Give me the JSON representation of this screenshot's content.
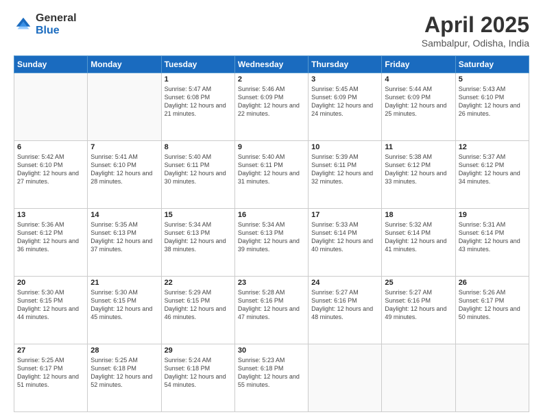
{
  "logo": {
    "general": "General",
    "blue": "Blue"
  },
  "title": {
    "month": "April 2025",
    "location": "Sambalpur, Odisha, India"
  },
  "weekdays": [
    "Sunday",
    "Monday",
    "Tuesday",
    "Wednesday",
    "Thursday",
    "Friday",
    "Saturday"
  ],
  "weeks": [
    [
      {
        "day": "",
        "sunrise": "",
        "sunset": "",
        "daylight": ""
      },
      {
        "day": "",
        "sunrise": "",
        "sunset": "",
        "daylight": ""
      },
      {
        "day": "1",
        "sunrise": "Sunrise: 5:47 AM",
        "sunset": "Sunset: 6:08 PM",
        "daylight": "Daylight: 12 hours and 21 minutes."
      },
      {
        "day": "2",
        "sunrise": "Sunrise: 5:46 AM",
        "sunset": "Sunset: 6:09 PM",
        "daylight": "Daylight: 12 hours and 22 minutes."
      },
      {
        "day": "3",
        "sunrise": "Sunrise: 5:45 AM",
        "sunset": "Sunset: 6:09 PM",
        "daylight": "Daylight: 12 hours and 24 minutes."
      },
      {
        "day": "4",
        "sunrise": "Sunrise: 5:44 AM",
        "sunset": "Sunset: 6:09 PM",
        "daylight": "Daylight: 12 hours and 25 minutes."
      },
      {
        "day": "5",
        "sunrise": "Sunrise: 5:43 AM",
        "sunset": "Sunset: 6:10 PM",
        "daylight": "Daylight: 12 hours and 26 minutes."
      }
    ],
    [
      {
        "day": "6",
        "sunrise": "Sunrise: 5:42 AM",
        "sunset": "Sunset: 6:10 PM",
        "daylight": "Daylight: 12 hours and 27 minutes."
      },
      {
        "day": "7",
        "sunrise": "Sunrise: 5:41 AM",
        "sunset": "Sunset: 6:10 PM",
        "daylight": "Daylight: 12 hours and 28 minutes."
      },
      {
        "day": "8",
        "sunrise": "Sunrise: 5:40 AM",
        "sunset": "Sunset: 6:11 PM",
        "daylight": "Daylight: 12 hours and 30 minutes."
      },
      {
        "day": "9",
        "sunrise": "Sunrise: 5:40 AM",
        "sunset": "Sunset: 6:11 PM",
        "daylight": "Daylight: 12 hours and 31 minutes."
      },
      {
        "day": "10",
        "sunrise": "Sunrise: 5:39 AM",
        "sunset": "Sunset: 6:11 PM",
        "daylight": "Daylight: 12 hours and 32 minutes."
      },
      {
        "day": "11",
        "sunrise": "Sunrise: 5:38 AM",
        "sunset": "Sunset: 6:12 PM",
        "daylight": "Daylight: 12 hours and 33 minutes."
      },
      {
        "day": "12",
        "sunrise": "Sunrise: 5:37 AM",
        "sunset": "Sunset: 6:12 PM",
        "daylight": "Daylight: 12 hours and 34 minutes."
      }
    ],
    [
      {
        "day": "13",
        "sunrise": "Sunrise: 5:36 AM",
        "sunset": "Sunset: 6:12 PM",
        "daylight": "Daylight: 12 hours and 36 minutes."
      },
      {
        "day": "14",
        "sunrise": "Sunrise: 5:35 AM",
        "sunset": "Sunset: 6:13 PM",
        "daylight": "Daylight: 12 hours and 37 minutes."
      },
      {
        "day": "15",
        "sunrise": "Sunrise: 5:34 AM",
        "sunset": "Sunset: 6:13 PM",
        "daylight": "Daylight: 12 hours and 38 minutes."
      },
      {
        "day": "16",
        "sunrise": "Sunrise: 5:34 AM",
        "sunset": "Sunset: 6:13 PM",
        "daylight": "Daylight: 12 hours and 39 minutes."
      },
      {
        "day": "17",
        "sunrise": "Sunrise: 5:33 AM",
        "sunset": "Sunset: 6:14 PM",
        "daylight": "Daylight: 12 hours and 40 minutes."
      },
      {
        "day": "18",
        "sunrise": "Sunrise: 5:32 AM",
        "sunset": "Sunset: 6:14 PM",
        "daylight": "Daylight: 12 hours and 41 minutes."
      },
      {
        "day": "19",
        "sunrise": "Sunrise: 5:31 AM",
        "sunset": "Sunset: 6:14 PM",
        "daylight": "Daylight: 12 hours and 43 minutes."
      }
    ],
    [
      {
        "day": "20",
        "sunrise": "Sunrise: 5:30 AM",
        "sunset": "Sunset: 6:15 PM",
        "daylight": "Daylight: 12 hours and 44 minutes."
      },
      {
        "day": "21",
        "sunrise": "Sunrise: 5:30 AM",
        "sunset": "Sunset: 6:15 PM",
        "daylight": "Daylight: 12 hours and 45 minutes."
      },
      {
        "day": "22",
        "sunrise": "Sunrise: 5:29 AM",
        "sunset": "Sunset: 6:15 PM",
        "daylight": "Daylight: 12 hours and 46 minutes."
      },
      {
        "day": "23",
        "sunrise": "Sunrise: 5:28 AM",
        "sunset": "Sunset: 6:16 PM",
        "daylight": "Daylight: 12 hours and 47 minutes."
      },
      {
        "day": "24",
        "sunrise": "Sunrise: 5:27 AM",
        "sunset": "Sunset: 6:16 PM",
        "daylight": "Daylight: 12 hours and 48 minutes."
      },
      {
        "day": "25",
        "sunrise": "Sunrise: 5:27 AM",
        "sunset": "Sunset: 6:16 PM",
        "daylight": "Daylight: 12 hours and 49 minutes."
      },
      {
        "day": "26",
        "sunrise": "Sunrise: 5:26 AM",
        "sunset": "Sunset: 6:17 PM",
        "daylight": "Daylight: 12 hours and 50 minutes."
      }
    ],
    [
      {
        "day": "27",
        "sunrise": "Sunrise: 5:25 AM",
        "sunset": "Sunset: 6:17 PM",
        "daylight": "Daylight: 12 hours and 51 minutes."
      },
      {
        "day": "28",
        "sunrise": "Sunrise: 5:25 AM",
        "sunset": "Sunset: 6:18 PM",
        "daylight": "Daylight: 12 hours and 52 minutes."
      },
      {
        "day": "29",
        "sunrise": "Sunrise: 5:24 AM",
        "sunset": "Sunset: 6:18 PM",
        "daylight": "Daylight: 12 hours and 54 minutes."
      },
      {
        "day": "30",
        "sunrise": "Sunrise: 5:23 AM",
        "sunset": "Sunset: 6:18 PM",
        "daylight": "Daylight: 12 hours and 55 minutes."
      },
      {
        "day": "",
        "sunrise": "",
        "sunset": "",
        "daylight": ""
      },
      {
        "day": "",
        "sunrise": "",
        "sunset": "",
        "daylight": ""
      },
      {
        "day": "",
        "sunrise": "",
        "sunset": "",
        "daylight": ""
      }
    ]
  ]
}
